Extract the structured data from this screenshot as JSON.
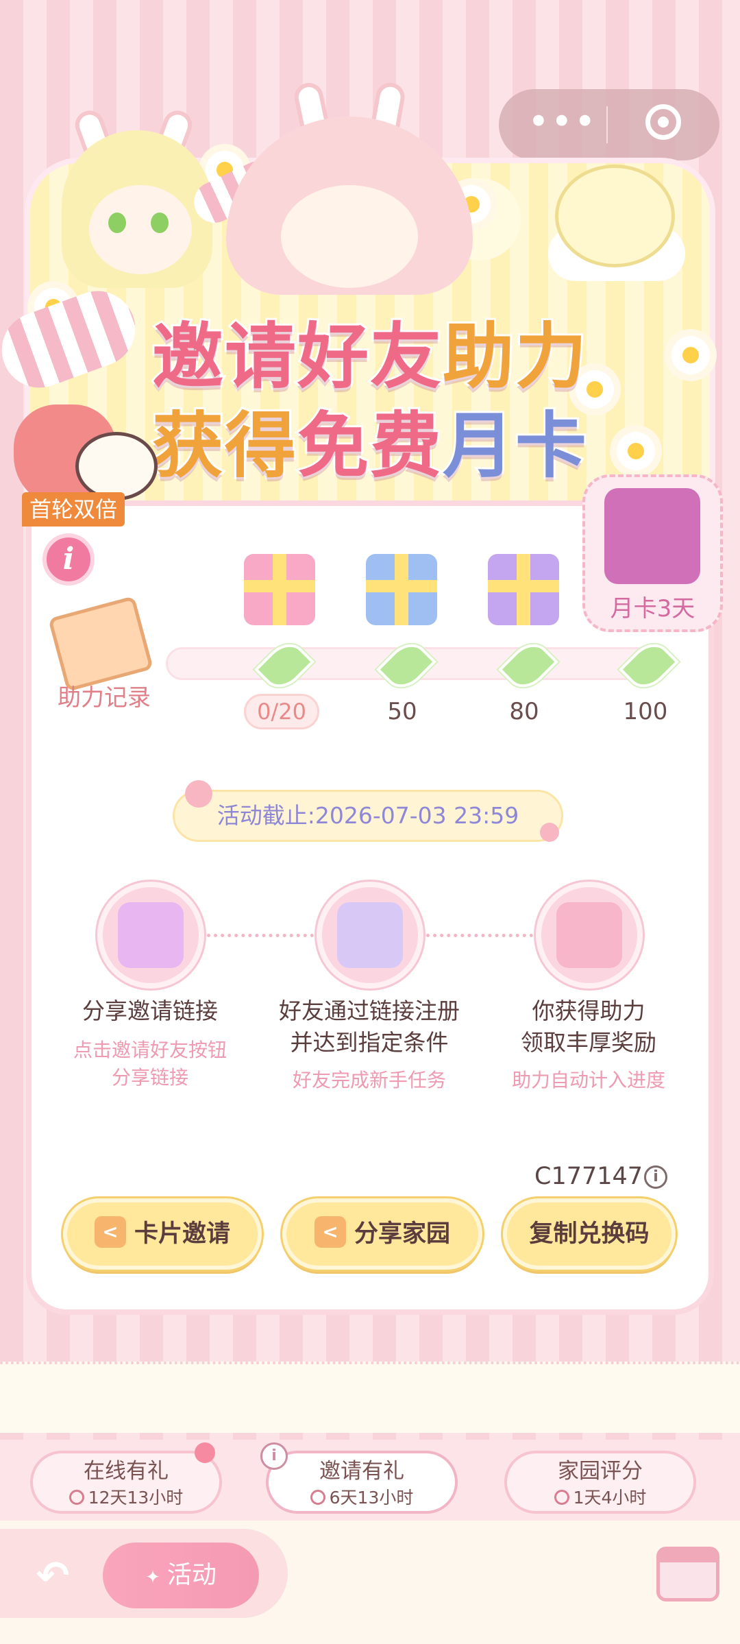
{
  "capsule": {
    "more_icon": "more-dots-icon",
    "close_icon": "target-close-icon"
  },
  "banner": {
    "title_line1": [
      "邀请好友",
      "助力"
    ],
    "title_line2": [
      "获得",
      "免费",
      "月卡"
    ]
  },
  "first_round_tag": "首轮双倍",
  "record": {
    "label": "助力记录"
  },
  "milestones": {
    "current": "0/20",
    "values": [
      "50",
      "80",
      "100"
    ],
    "progress_fraction": 0.0,
    "reward_label": "月卡3天"
  },
  "deadline": "活动截止:2026-07-03 23:59",
  "steps": [
    {
      "title_lines": [
        "分享邀请链接"
      ],
      "sub_lines": [
        "点击邀请好友按钮",
        "分享链接"
      ]
    },
    {
      "title_lines": [
        "好友通过链接注册",
        "并达到指定条件"
      ],
      "sub_lines": [
        "好友完成新手任务"
      ]
    },
    {
      "title_lines": [
        "你获得助力",
        "领取丰厚奖励"
      ],
      "sub_lines": [
        "助力自动计入进度"
      ]
    }
  ],
  "invite_code": "C177147",
  "buttons": {
    "card_invite": "卡片邀请",
    "share_home": "分享家园",
    "copy_code": "复制兑换码"
  },
  "tabs": [
    {
      "name": "在线有礼",
      "time": "12天13小时"
    },
    {
      "name": "邀请有礼",
      "time": "6天13小时"
    },
    {
      "name": "家园评分",
      "time": "1天4小时"
    }
  ],
  "footer": {
    "activity_label": "活动"
  },
  "colors": {
    "accent_pink": "#f17aa0",
    "button_yellow": "#ffe89c",
    "deadline_text": "#8e86d6"
  }
}
